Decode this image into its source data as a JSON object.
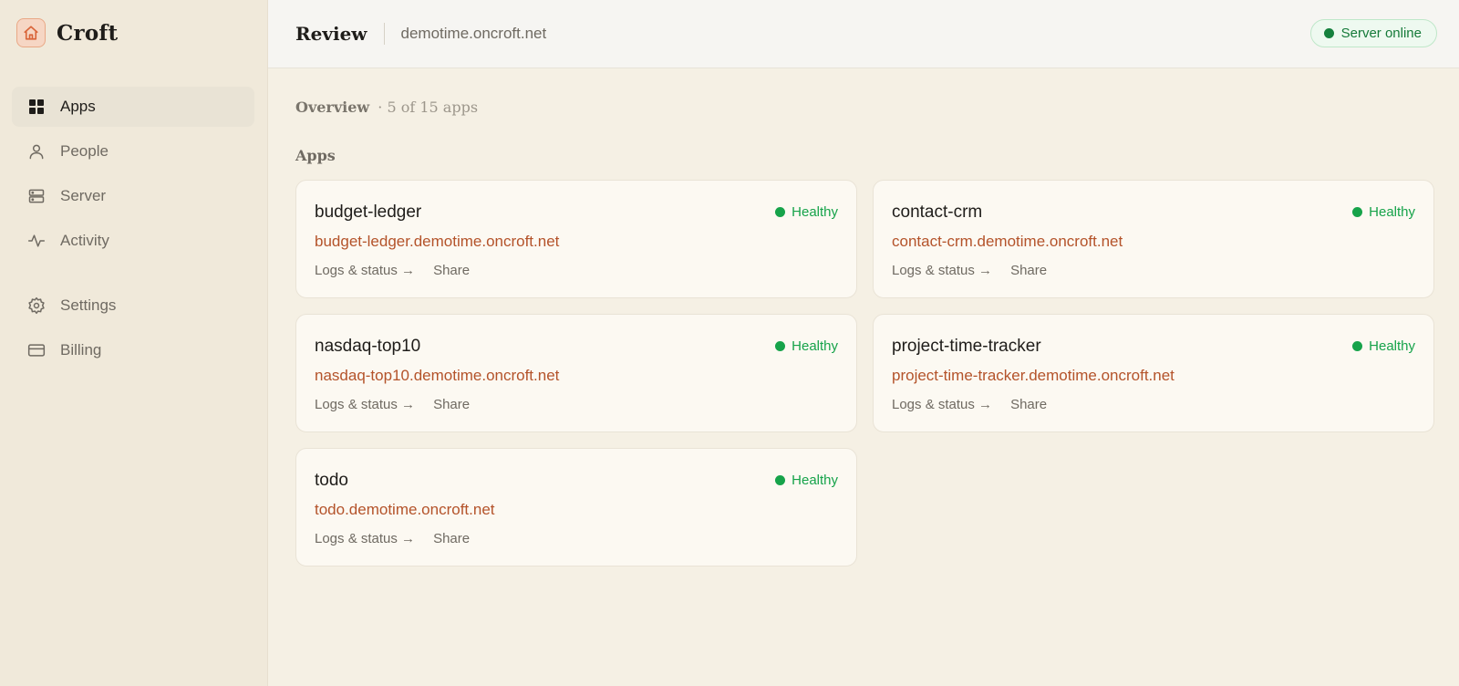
{
  "brand": {
    "name": "Croft",
    "icon": "home-icon",
    "accent": "#d9653a"
  },
  "sidebar": {
    "items": [
      {
        "label": "Apps",
        "icon": "grid-icon",
        "active": true
      },
      {
        "label": "People",
        "icon": "user-icon",
        "active": false
      },
      {
        "label": "Server",
        "icon": "server-icon",
        "active": false
      },
      {
        "label": "Activity",
        "icon": "activity-icon",
        "active": false
      },
      {
        "label": "Settings",
        "icon": "gear-icon",
        "active": false
      },
      {
        "label": "Billing",
        "icon": "credit-card-icon",
        "active": false
      }
    ]
  },
  "header": {
    "title": "Review",
    "host": "demotime.oncroft.net",
    "server_status": "Server online",
    "server_status_color": "#15803d"
  },
  "overview": {
    "title": "Overview",
    "count": "· 5 of 15 apps"
  },
  "apps_section": {
    "title": "Apps",
    "cards": [
      {
        "name": "budget-ledger",
        "url": "budget-ledger.demotime.oncroft.net",
        "status": "Healthy",
        "logs_label": "Logs & status →",
        "share_label": "Share"
      },
      {
        "name": "contact-crm",
        "url": "contact-crm.demotime.oncroft.net",
        "status": "Healthy",
        "logs_label": "Logs & status →",
        "share_label": "Share"
      },
      {
        "name": "nasdaq-top10",
        "url": "nasdaq-top10.demotime.oncroft.net",
        "status": "Healthy",
        "logs_label": "Logs & status →",
        "share_label": "Share"
      },
      {
        "name": "project-time-tracker",
        "url": "project-time-tracker.demotime.oncroft.net",
        "status": "Healthy",
        "logs_label": "Logs & status →",
        "share_label": "Share"
      },
      {
        "name": "todo",
        "url": "todo.demotime.oncroft.net",
        "status": "Healthy",
        "logs_label": "Logs & status →",
        "share_label": "Share"
      }
    ]
  },
  "colors": {
    "healthy": "#16a34a",
    "link": "#b4532a"
  }
}
